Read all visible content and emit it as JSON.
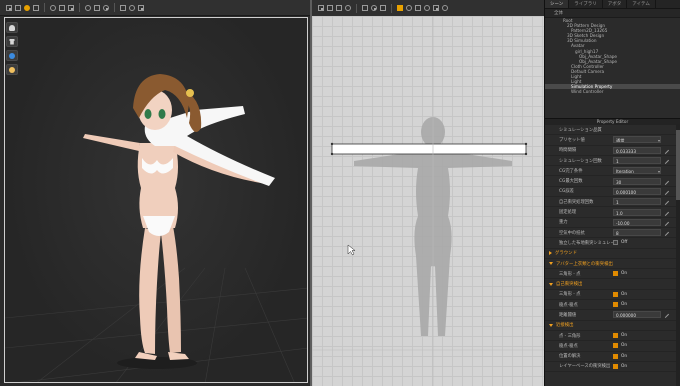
{
  "tabs": [
    {
      "label": "シーン",
      "active": true
    },
    {
      "label": "ライブラリ",
      "active": false
    },
    {
      "label": "アボタ",
      "active": false
    },
    {
      "label": "アイテム",
      "active": false
    }
  ],
  "object_browser": {
    "header": "全体",
    "tree": [
      {
        "label": "Root",
        "depth": 0,
        "selected": false
      },
      {
        "label": "2D Pattern Design",
        "depth": 1,
        "selected": false
      },
      {
        "label": "Pattern2D_13265",
        "depth": 2,
        "selected": false
      },
      {
        "label": "3D Sketch Design",
        "depth": 1,
        "selected": false
      },
      {
        "label": "3D Simulation",
        "depth": 1,
        "selected": false
      },
      {
        "label": "Avatar",
        "depth": 2,
        "selected": false
      },
      {
        "label": "girl_high17",
        "depth": 3,
        "selected": false
      },
      {
        "label": "Obj_Avatar_Shape",
        "depth": 4,
        "selected": false
      },
      {
        "label": "Obj_Avatar_Shape",
        "depth": 4,
        "selected": false
      },
      {
        "label": "Cloth Controller",
        "depth": 2,
        "selected": false
      },
      {
        "label": "Default Camera",
        "depth": 2,
        "selected": false
      },
      {
        "label": "Light",
        "depth": 2,
        "selected": false
      },
      {
        "label": "Light",
        "depth": 2,
        "selected": false
      },
      {
        "label": "Simulation Property",
        "depth": 2,
        "selected": true
      },
      {
        "label": "Wind Controller",
        "depth": 2,
        "selected": false
      }
    ]
  },
  "property_editor": {
    "title": "Property Editor",
    "rows": [
      {
        "kind": "prop",
        "label": "シミュレーション品質",
        "value": "",
        "control": "none"
      },
      {
        "kind": "prop",
        "label": "プリセット値",
        "value": "通常",
        "control": "dropdown"
      },
      {
        "kind": "prop",
        "label": "時間間隔",
        "value": "0.033333",
        "control": "pen"
      },
      {
        "kind": "prop",
        "label": "シミュレーション回数",
        "value": "1",
        "control": "pen"
      },
      {
        "kind": "prop",
        "label": "CG完了条件",
        "value": "Iteration",
        "control": "dropdown"
      },
      {
        "kind": "prop",
        "label": "CG最大回数",
        "value": "30",
        "control": "pen"
      },
      {
        "kind": "prop",
        "label": "CG誤差",
        "value": "0.000100",
        "control": "pen"
      },
      {
        "kind": "prop",
        "label": "自己衝突処理回数",
        "value": "1",
        "control": "pen"
      },
      {
        "kind": "prop",
        "label": "固定処理",
        "value": "1.0",
        "control": "pen"
      },
      {
        "kind": "prop",
        "label": "重力",
        "value": "-10.00",
        "control": "pen"
      },
      {
        "kind": "prop",
        "label": "空気中の抵抗",
        "value": "8",
        "control": "pen"
      },
      {
        "kind": "check",
        "label": "独立した布地衝突シミュレーション",
        "checked": false,
        "state": "Off"
      },
      {
        "kind": "section",
        "label": "グラウンド",
        "expanded": false
      },
      {
        "kind": "section",
        "label": "アバター上衣類との衝突検出",
        "expanded": true
      },
      {
        "kind": "check",
        "label": "三角形 - 点",
        "checked": true,
        "state": "On"
      },
      {
        "kind": "section",
        "label": "自己衝突検出",
        "expanded": true
      },
      {
        "kind": "check",
        "label": "三角形 - 点",
        "checked": true,
        "state": "On"
      },
      {
        "kind": "check",
        "label": "稜点-稜点",
        "checked": true,
        "state": "On"
      },
      {
        "kind": "prop",
        "label": "距離閾値",
        "value": "0.000000",
        "control": "pen"
      },
      {
        "kind": "section",
        "label": "近接検出",
        "expanded": true
      },
      {
        "kind": "check",
        "label": "点 - 三角形",
        "checked": true,
        "state": "On"
      },
      {
        "kind": "check",
        "label": "稜点-稜点",
        "checked": true,
        "state": "On"
      },
      {
        "kind": "check",
        "label": "位置の解決",
        "checked": true,
        "state": "On"
      },
      {
        "kind": "check",
        "label": "レイヤーベースの衝突検出",
        "checked": true,
        "state": "On"
      }
    ]
  },
  "colors": {
    "accent": "#e8a100",
    "section_header": "#f0a020",
    "viewport_bg": "#2a2a2a",
    "grid_bg": "#d4d4d4"
  },
  "icons_3d_toolbar": [
    "select-icon",
    "transform-icon",
    "move-icon",
    "pin-icon",
    "tack-icon",
    "brush-icon",
    "fold-icon",
    "shape-icon",
    "camera-icon",
    "avatar-icon",
    "measure-icon",
    "tape-icon",
    "sewing-icon"
  ],
  "icons_2d_toolbar": [
    "select-icon",
    "polygon-icon",
    "rectangle-icon",
    "circle-icon",
    "internal-icon",
    "dart-icon",
    "segment-icon",
    "sewing-icon",
    "fold-icon",
    "pin-icon",
    "texture-icon",
    "material-icon",
    "snap-icon"
  ]
}
